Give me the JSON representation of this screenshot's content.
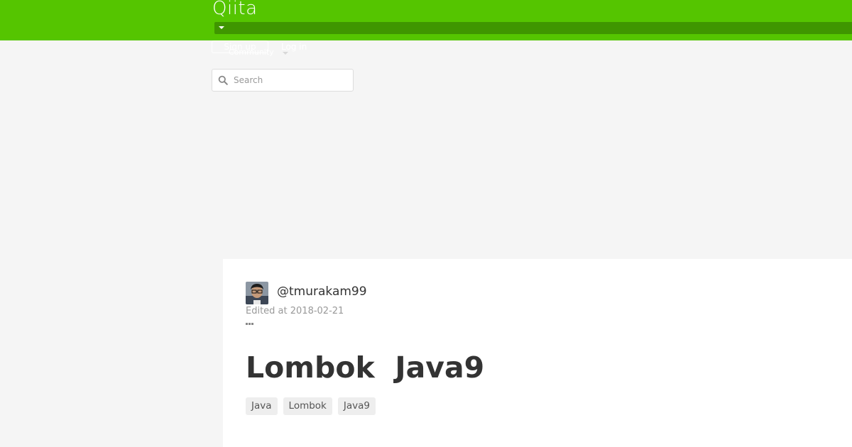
{
  "header": {
    "logo_text": "Qiita",
    "signup_label": "Sign up",
    "login_label": "Log in",
    "community_label": "Community",
    "search_placeholder": "Search",
    "brand_color": "#55c500"
  },
  "article": {
    "author": "@tmurakam99",
    "edited": "Edited at 2018-02-21",
    "title": "Lombok  Java9",
    "tags": [
      "Java",
      "Lombok",
      "Java9"
    ]
  }
}
